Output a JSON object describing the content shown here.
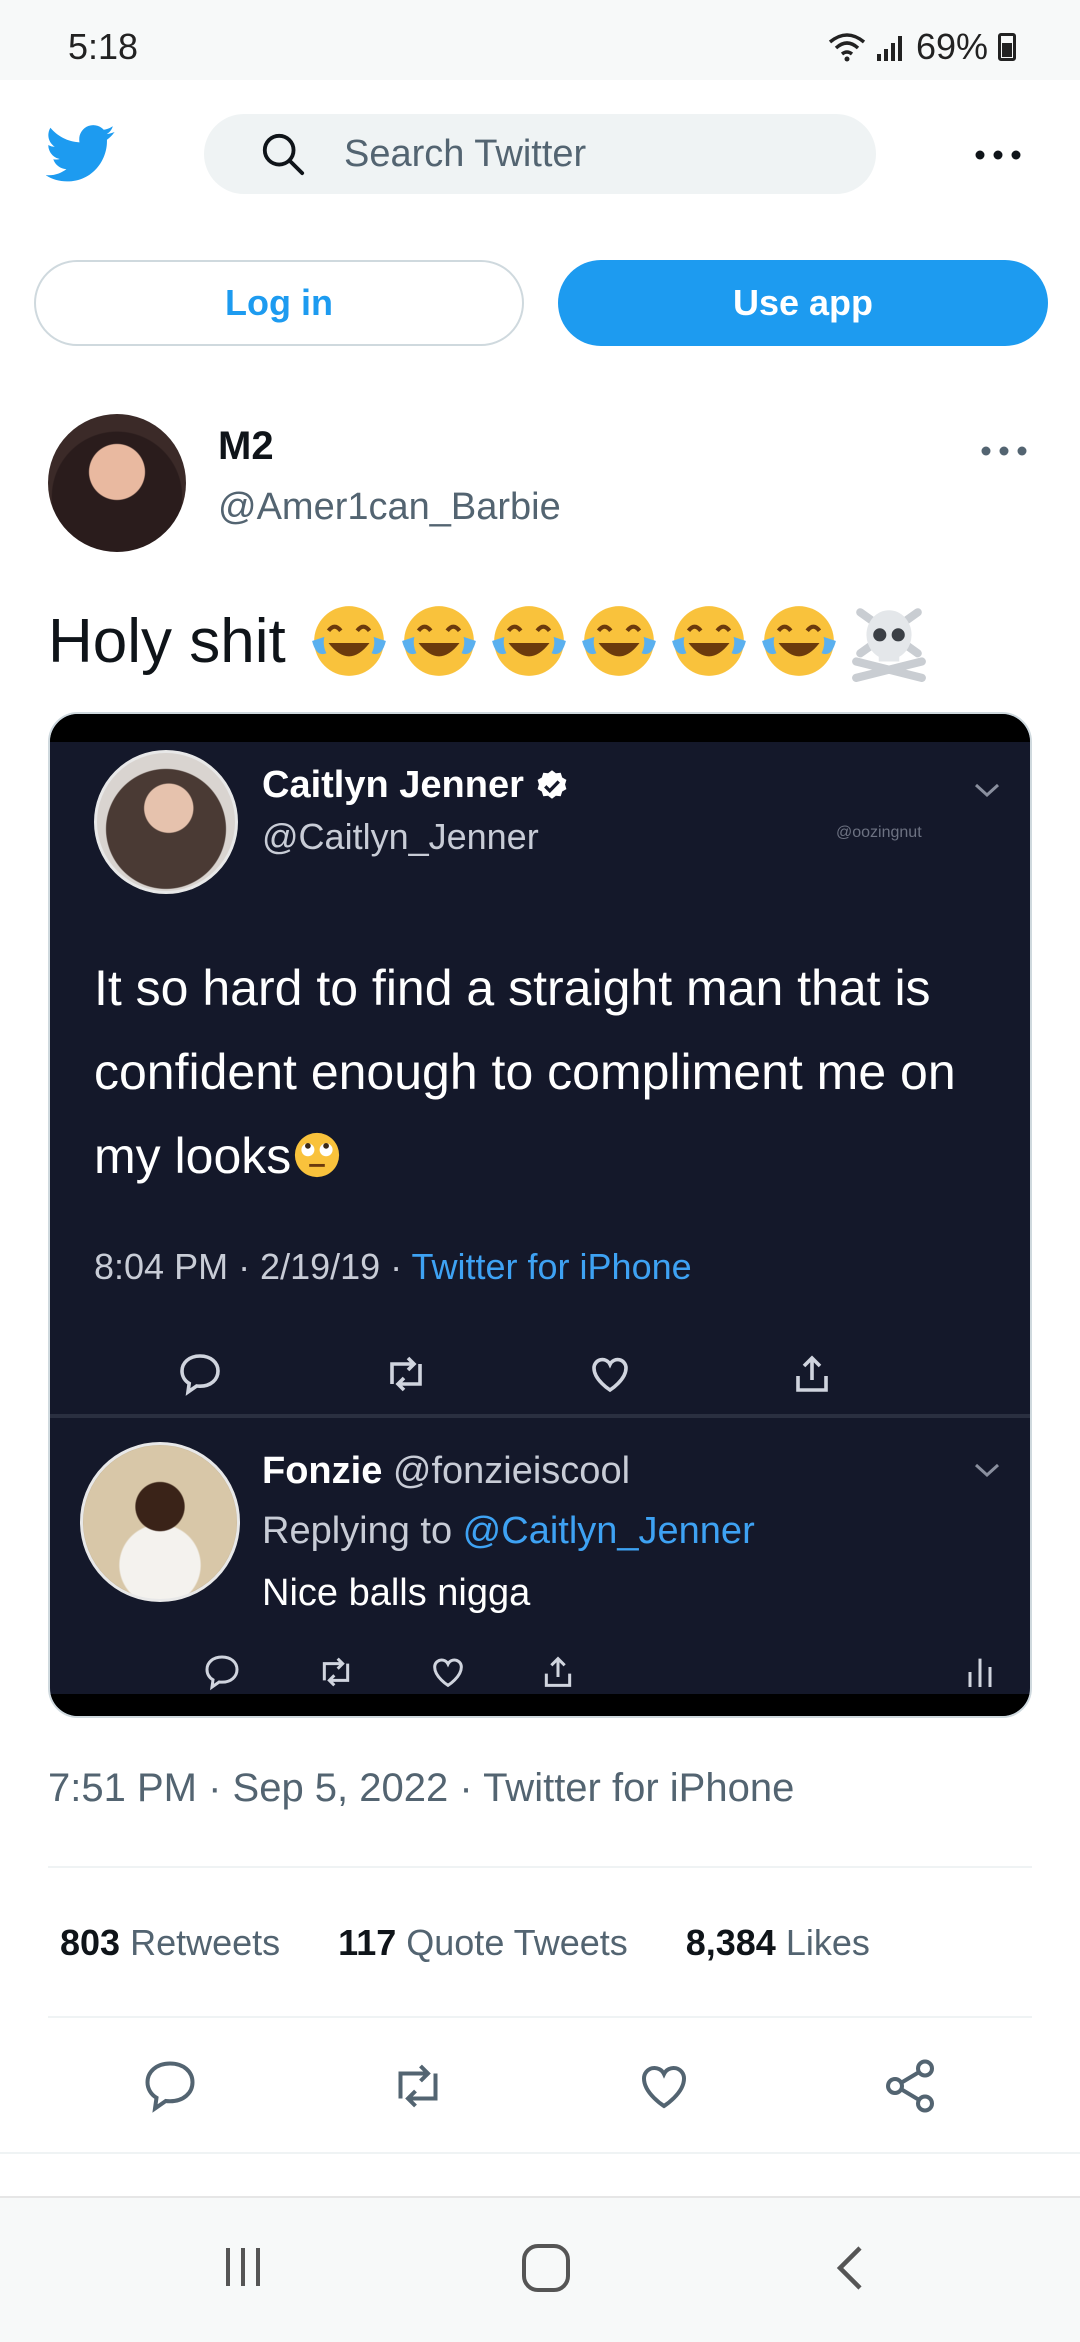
{
  "status_bar": {
    "time": "5:18",
    "battery": "69%"
  },
  "search": {
    "placeholder": "Search Twitter"
  },
  "auth": {
    "login_label": "Log in",
    "use_app_label": "Use app"
  },
  "tweet": {
    "display_name": "M2",
    "handle": "@Amer1can_Barbie",
    "text": "Holy shit",
    "emoji": [
      "face-with-tears-of-joy",
      "face-with-tears-of-joy",
      "face-with-tears-of-joy",
      "face-with-tears-of-joy",
      "face-with-tears-of-joy",
      "face-with-tears-of-joy",
      "skull-and-crossbones"
    ],
    "timestamp": "7:51 PM · Sep 5, 2022 · Twitter for iPhone",
    "stats": [
      {
        "count": "803",
        "label": "Retweets"
      },
      {
        "count": "117",
        "label": "Quote Tweets"
      },
      {
        "count": "8,384",
        "label": "Likes"
      }
    ]
  },
  "embedded_screenshot": {
    "original": {
      "name": "Caitlyn Jenner",
      "handle": "@Caitlyn_Jenner",
      "watermark": "@oozingnut",
      "text": "It so hard to find a straight man that is confident enough to compliment me on my looks",
      "meta_time": "8:04 PM · 2/19/19 · ",
      "meta_source": "Twitter for iPhone"
    },
    "reply": {
      "name": "Fonzie",
      "handle": "@fonzieiscool",
      "replying_prefix": "Replying to ",
      "replying_to": "@Caitlyn_Jenner",
      "text": "Nice balls nigga"
    }
  },
  "colors": {
    "accent": "#1d9bf0",
    "secondary_text": "#536471",
    "embed_bg": "#14182a"
  },
  "icons": [
    "twitter-logo-icon",
    "search-icon",
    "more-icon",
    "verified-icon",
    "reply-icon",
    "retweet-icon",
    "like-icon",
    "share-icon",
    "analytics-icon",
    "chevron-down-icon",
    "recent-apps-icon",
    "home-icon",
    "back-icon"
  ]
}
